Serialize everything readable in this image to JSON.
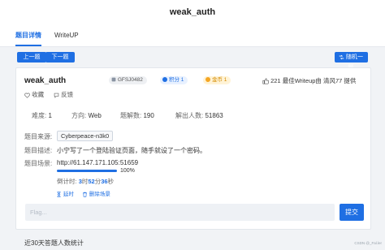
{
  "page": {
    "title": "weak_auth"
  },
  "tabs": [
    {
      "label": "题目详情",
      "active": true
    },
    {
      "label": "WriteUP",
      "active": false
    }
  ],
  "toolbar": {
    "prev_label": "上一题",
    "next_label": "下一题",
    "random_label": "随机一题"
  },
  "challenge": {
    "name": "weak_auth",
    "id": "GFSJ0482",
    "points_label": "积分 1",
    "coins_label": "金币 1",
    "likes": "221",
    "best_writeup": "最佳Writeup由 清风77 提供",
    "favorite_label": "收藏",
    "feedback_label": "反馈",
    "difficulty_label": "难度:",
    "difficulty_value": "1",
    "direction_label": "方向:",
    "direction_value": "Web",
    "solved_label": "题解数:",
    "solved_value": "190",
    "solvers_label": "解出人数:",
    "solvers_value": "51863",
    "source_label": "题目来源:",
    "source_value": "Cyberpeace-n3k0",
    "desc_label": "题目描述:",
    "desc_value": "小宁写了一个登陆验证页面，随手就设了一个密码。",
    "scene_label": "题目场景:",
    "scene_url": "http://61.147.171.105:51659",
    "progress": 1.0,
    "progress_text": "100%",
    "countdown_label": "倒计时:",
    "countdown_hours": "3",
    "countdown_hours_unit": "时",
    "countdown_minutes": "52",
    "countdown_minutes_unit": "分",
    "countdown_seconds": "36",
    "countdown_seconds_unit": "秒",
    "renew_label": "延时",
    "delete_label": "删除场景"
  },
  "flag": {
    "placeholder": "Flag...",
    "submit_label": "提交"
  },
  "bottom": {
    "heading": "近30天答题人数统计"
  },
  "watermark": "CSDN @_Fal.ler",
  "colors": {
    "accent": "#1f6fe3",
    "points_badge": "#e8f1ff",
    "coins_badge": "#fff3d6",
    "id_badge": "#eef0f3"
  }
}
